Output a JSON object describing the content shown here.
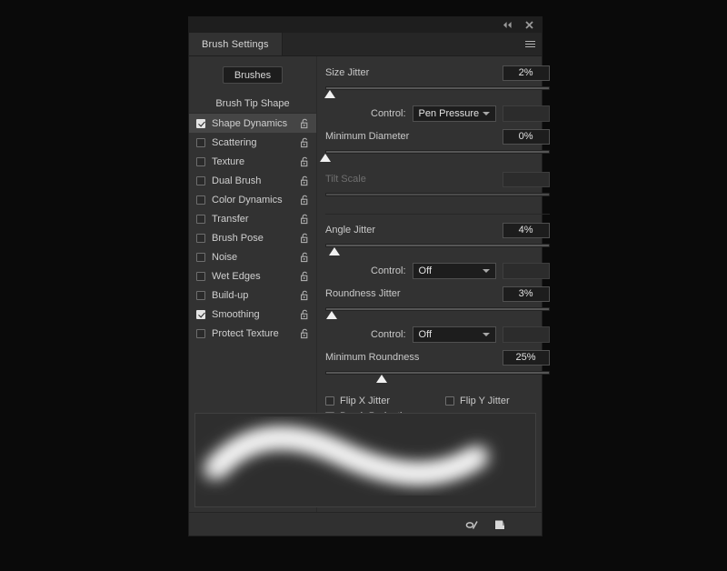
{
  "window": {
    "collapse_icon": "double-chevron-left-icon",
    "close_icon": "close-icon"
  },
  "tab": {
    "label": "Brush Settings",
    "menu_icon": "hamburger-menu-icon"
  },
  "left_panel": {
    "brushes_button": "Brushes",
    "tip_shape_header": "Brush Tip Shape",
    "lock_icon": "padlock-open-icon",
    "options": [
      {
        "label": "Shape Dynamics",
        "checked": true,
        "selected": true,
        "locked": false
      },
      {
        "label": "Scattering",
        "checked": false,
        "selected": false,
        "locked": false
      },
      {
        "label": "Texture",
        "checked": false,
        "selected": false,
        "locked": false
      },
      {
        "label": "Dual Brush",
        "checked": false,
        "selected": false,
        "locked": false
      },
      {
        "label": "Color Dynamics",
        "checked": false,
        "selected": false,
        "locked": false
      },
      {
        "label": "Transfer",
        "checked": false,
        "selected": false,
        "locked": false
      },
      {
        "label": "Brush Pose",
        "checked": false,
        "selected": false,
        "locked": false
      },
      {
        "label": "Noise",
        "checked": false,
        "selected": false,
        "locked": false
      },
      {
        "label": "Wet Edges",
        "checked": false,
        "selected": false,
        "locked": false
      },
      {
        "label": "Build-up",
        "checked": false,
        "selected": false,
        "locked": false
      },
      {
        "label": "Smoothing",
        "checked": true,
        "selected": false,
        "locked": false
      },
      {
        "label": "Protect Texture",
        "checked": false,
        "selected": false,
        "locked": false
      }
    ]
  },
  "settings": {
    "size_jitter": {
      "label": "Size Jitter",
      "value": "2%",
      "slider_pct": 2
    },
    "size_control": {
      "label": "Control:",
      "value": "Pen Pressure",
      "side_value": ""
    },
    "minimum_diameter": {
      "label": "Minimum Diameter",
      "value": "0%",
      "slider_pct": 0
    },
    "tilt_scale": {
      "label": "Tilt Scale",
      "value": "",
      "slider_pct": 0,
      "disabled": true
    },
    "angle_jitter": {
      "label": "Angle Jitter",
      "value": "4%",
      "slider_pct": 4
    },
    "angle_control": {
      "label": "Control:",
      "value": "Off",
      "side_value": ""
    },
    "roundness_jitter": {
      "label": "Roundness Jitter",
      "value": "3%",
      "slider_pct": 3
    },
    "roundness_control": {
      "label": "Control:",
      "value": "Off",
      "side_value": ""
    },
    "minimum_roundness": {
      "label": "Minimum Roundness",
      "value": "25%",
      "slider_pct": 25
    },
    "flip_x": {
      "label": "Flip X Jitter",
      "checked": false
    },
    "flip_y": {
      "label": "Flip Y Jitter",
      "checked": false
    },
    "brush_projection": {
      "label": "Brush Projection",
      "checked": false
    }
  },
  "preview": {
    "name": "brush-stroke-preview",
    "stroke_color": "#ffffff",
    "background": "#2e2e2e"
  },
  "footer": {
    "toggle_icon": "brush-pressure-toggle-icon",
    "new_brush_icon": "new-brush-preset-icon"
  },
  "colors": {
    "panel_bg": "#323232",
    "panel_border": "#1e1e1e",
    "selected_row": "#454545",
    "field_bg": "#1d1d1d",
    "text": "#c9c9c9",
    "desktop_bg": "#0a0a0a"
  }
}
